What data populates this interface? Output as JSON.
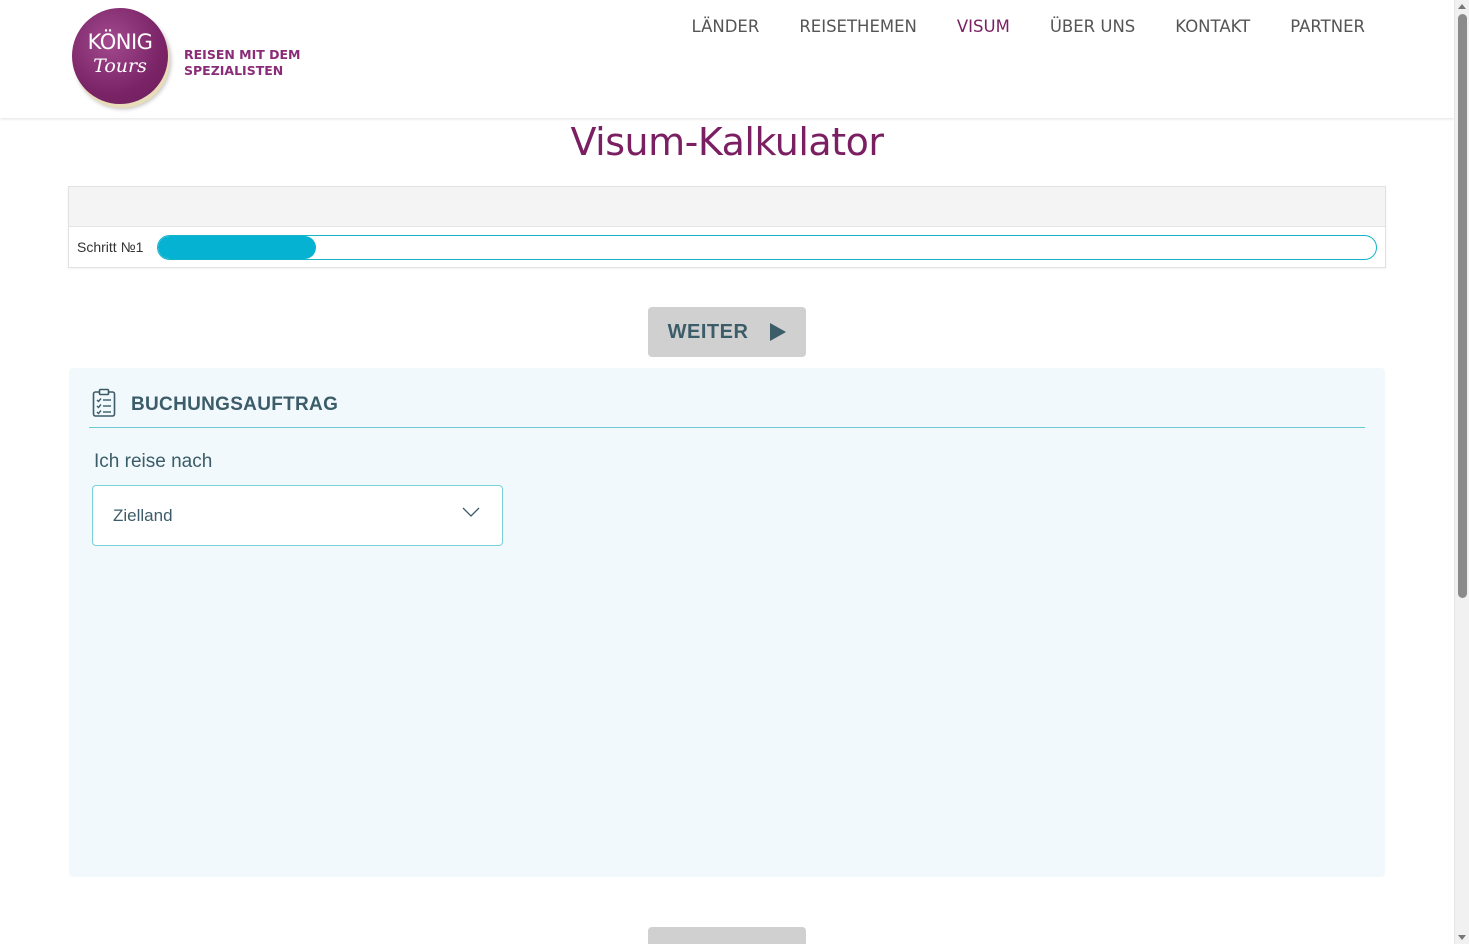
{
  "header": {
    "logo_line1": "KÖNIG",
    "logo_line2": "Tours",
    "tagline_line1": "REISEN MIT DEM",
    "tagline_line2": "SPEZIALISTEN",
    "nav": [
      {
        "label": "LÄNDER",
        "active": false
      },
      {
        "label": "REISETHEMEN",
        "active": false
      },
      {
        "label": "VISUM",
        "active": true
      },
      {
        "label": "ÜBER UNS",
        "active": false
      },
      {
        "label": "KONTAKT",
        "active": false
      },
      {
        "label": "PARTNER",
        "active": false
      }
    ]
  },
  "page": {
    "title": "Visum-Kalkulator"
  },
  "progress": {
    "step_label": "Schritt №1",
    "fraction": 0.13
  },
  "actions": {
    "weiter_label": "WEITER",
    "weiter_icon": "play-icon"
  },
  "booking": {
    "title": "BUCHUNGSAUFTRAG",
    "icon": "clipboard-checklist-icon",
    "destination_label": "Ich reise nach",
    "destination_value": "Zielland",
    "destination_icon": "chevron-down-icon"
  },
  "colors": {
    "brand": "#7b1f63",
    "accent": "#05b2d2",
    "text_dark": "#3b5c68",
    "panel_bg": "#f1f9fc"
  }
}
